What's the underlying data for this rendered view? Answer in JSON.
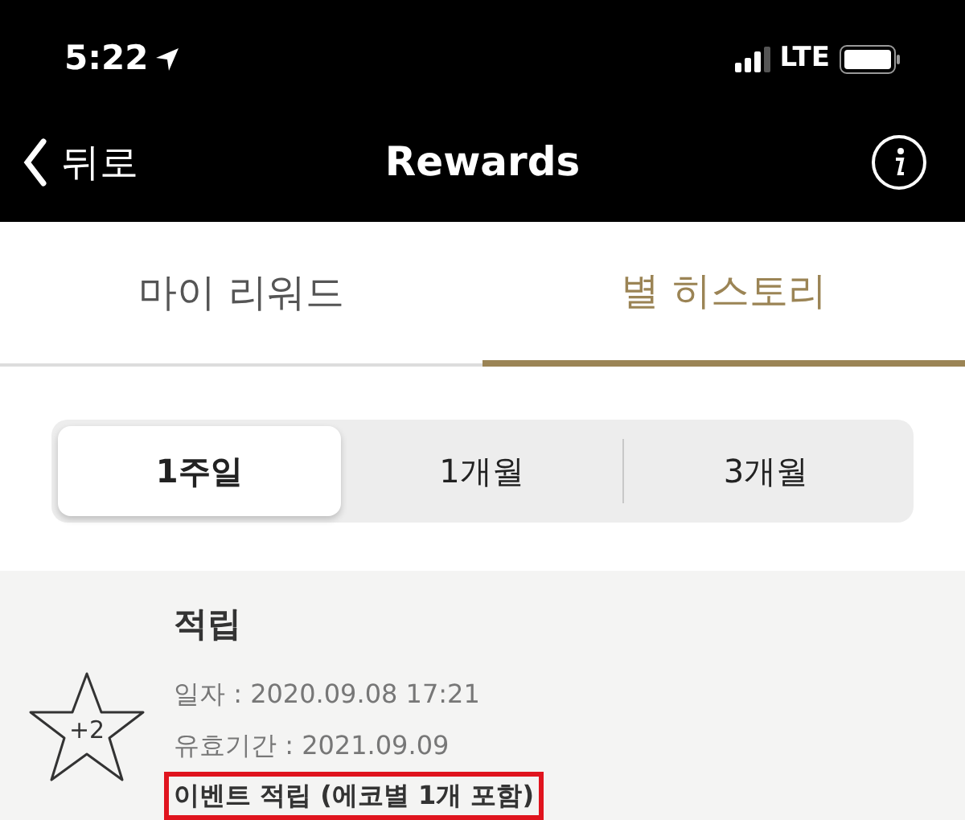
{
  "status_bar": {
    "time": "5:22",
    "network": "LTE"
  },
  "nav": {
    "back": "뒤로",
    "title": "Rewards"
  },
  "tabs": [
    {
      "label": "마이 리워드",
      "selected": false
    },
    {
      "label": "별 히스토리",
      "selected": true
    }
  ],
  "periods": [
    {
      "label": "1주일",
      "selected": true
    },
    {
      "label": "1개월",
      "selected": false
    },
    {
      "label": "3개월",
      "selected": false
    }
  ],
  "history": [
    {
      "title": "적립",
      "stars": "+2",
      "date": "일자 : 2020.09.08 17:21",
      "expiry": "유효기간 : 2021.09.09",
      "note": "이벤트 적립 (에코별 1개 포함)",
      "highlighted": true
    }
  ]
}
